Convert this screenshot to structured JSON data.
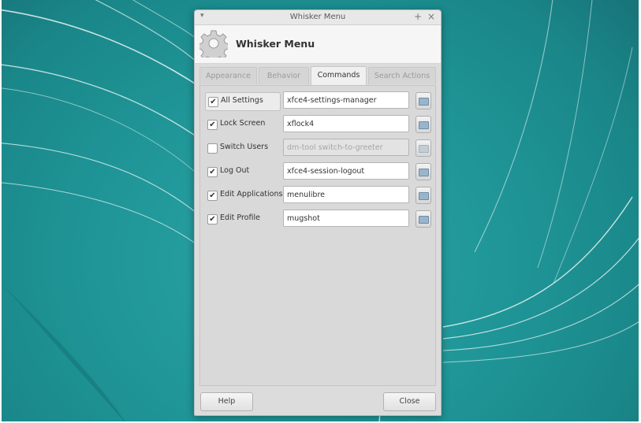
{
  "window": {
    "title": "Whisker Menu",
    "menu_icon": "triangle-down-icon",
    "maximize_icon": "plus-icon",
    "close_icon": "close-icon"
  },
  "header": {
    "icon": "gear-icon",
    "title": "Whisker Menu"
  },
  "tabs": [
    {
      "label": "Appearance",
      "active": false
    },
    {
      "label": "Behavior",
      "active": false
    },
    {
      "label": "Commands",
      "active": true
    },
    {
      "label": "Search Actions",
      "active": false
    }
  ],
  "commands": [
    {
      "label": "All Settings",
      "checked": true,
      "command": "xfce4-settings-manager",
      "enabled": true
    },
    {
      "label": "Lock Screen",
      "checked": true,
      "command": "xflock4",
      "enabled": true
    },
    {
      "label": "Switch Users",
      "checked": false,
      "command": "dm-tool switch-to-greeter",
      "enabled": false
    },
    {
      "label": "Log Out",
      "checked": true,
      "command": "xfce4-session-logout",
      "enabled": true
    },
    {
      "label": "Edit Applications",
      "checked": true,
      "command": "menulibre",
      "enabled": true
    },
    {
      "label": "Edit Profile",
      "checked": true,
      "command": "mugshot",
      "enabled": true
    }
  ],
  "footer": {
    "help_label": "Help",
    "close_label": "Close"
  },
  "colors": {
    "desktop": "#1f9597",
    "window_bg": "#dcdcdc",
    "active_tab": "#f0f0f0"
  }
}
